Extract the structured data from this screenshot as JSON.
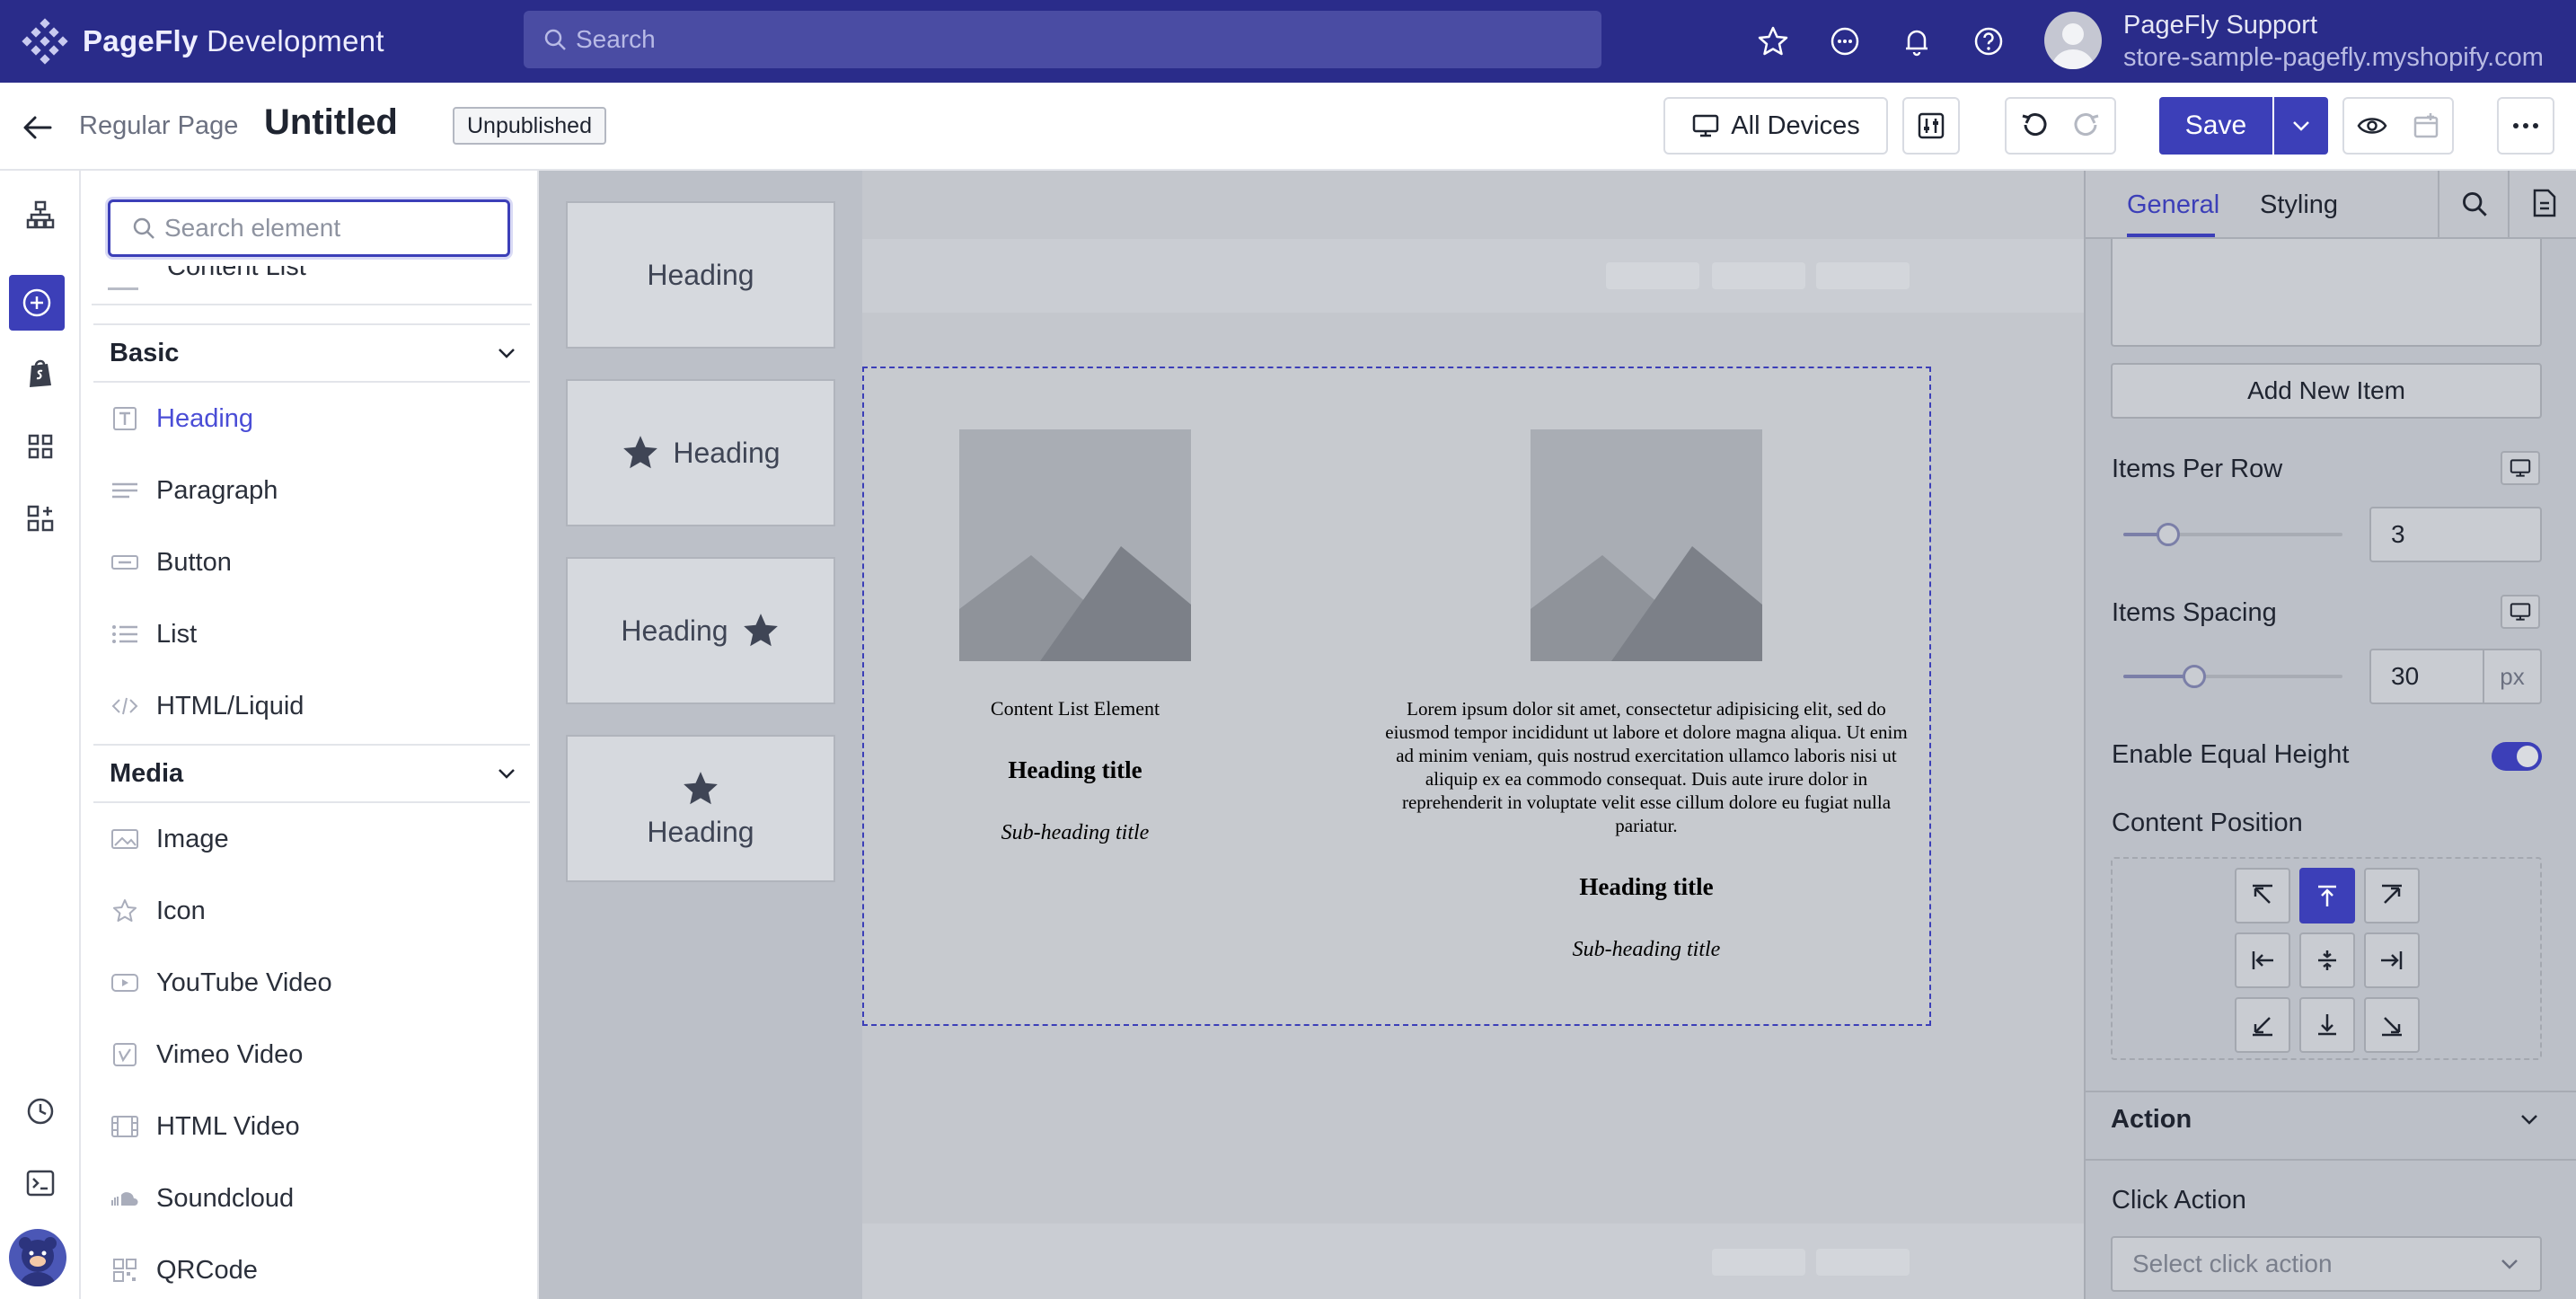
{
  "topbar": {
    "brand_name": "PageFly",
    "brand_suffix": "Development",
    "search_placeholder": "Search",
    "user_name": "PageFly Support",
    "user_store": "store-sample-pagefly.myshopify.com",
    "icons": [
      "star-icon",
      "chat-icon",
      "bell-icon",
      "help-icon"
    ]
  },
  "header": {
    "page_type": "Regular Page",
    "page_title": "Untitled",
    "status_badge": "Unpublished",
    "devices_label": "All Devices",
    "save_label": "Save"
  },
  "element_panel": {
    "search_placeholder": "Search element",
    "cut_item": "Content List",
    "sections": [
      {
        "title": "Basic",
        "items": [
          "Heading",
          "Paragraph",
          "Button",
          "List",
          "HTML/Liquid"
        ]
      },
      {
        "title": "Media",
        "items": [
          "Image",
          "Icon",
          "YouTube Video",
          "Vimeo Video",
          "HTML Video",
          "Soundcloud",
          "QRCode"
        ]
      }
    ],
    "active_item": "Heading",
    "accent_color": "#4a4dd6"
  },
  "variants": [
    {
      "label": "Heading",
      "icon": "none"
    },
    {
      "label": "Heading",
      "icon": "star-left"
    },
    {
      "label": "Heading",
      "icon": "star-right"
    },
    {
      "label": "Heading",
      "icon": "star-top"
    }
  ],
  "canvas": {
    "items": [
      {
        "text": "Content List Element",
        "heading": "Heading title",
        "subheading": "Sub-heading title"
      },
      {
        "text": "Lorem ipsum dolor sit amet, consectetur adipisicing elit, sed do eiusmod tempor incididunt ut labore et dolore magna aliqua. Ut enim ad minim veniam, quis nostrud exercitation ullamco laboris nisi ut aliquip ex ea commodo consequat. Duis aute irure dolor in reprehenderit in voluptate velit esse cillum dolore eu fugiat nulla pariatur.",
        "heading": "Heading title",
        "subheading": "Sub-heading title"
      }
    ]
  },
  "right_panel": {
    "tabs": [
      "General",
      "Styling"
    ],
    "active_tab": "General",
    "add_item_label": "Add New Item",
    "items_per_row_label": "Items Per Row",
    "items_per_row_value": "3",
    "items_per_row_slider": 0.18,
    "items_spacing_label": "Items Spacing",
    "items_spacing_value": "30",
    "items_spacing_unit": "px",
    "items_spacing_slider": 0.3,
    "equal_height_label": "Enable Equal Height",
    "equal_height_on": true,
    "content_position_label": "Content Position",
    "content_position_active": "top-center",
    "action_section": "Action",
    "click_action_label": "Click Action",
    "click_action_placeholder": "Select click action"
  }
}
